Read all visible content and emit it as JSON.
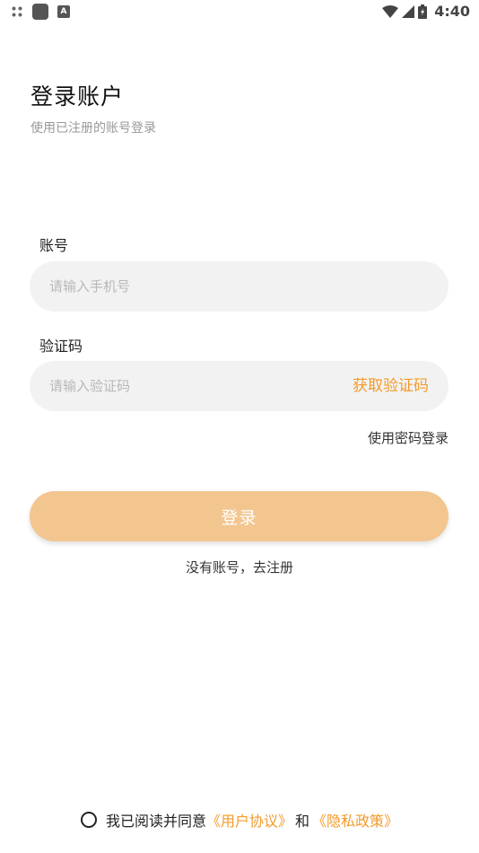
{
  "status_bar": {
    "time": "4:40",
    "left_icons": [
      "grid-icon",
      "app-square-icon",
      "a-box-icon"
    ],
    "right_icons": [
      "wifi-icon",
      "signal-icon",
      "battery-icon"
    ]
  },
  "header": {
    "title": "登录账户",
    "subtitle": "使用已注册的账号登录"
  },
  "form": {
    "account_label": "账号",
    "account_placeholder": "请输入手机号",
    "code_label": "验证码",
    "code_placeholder": "请输入验证码",
    "get_code_label": "获取验证码",
    "password_login_label": "使用密码登录"
  },
  "actions": {
    "login_label": "登录",
    "register_label": "没有账号，去注册"
  },
  "agreement": {
    "prefix": "我已阅读并同意",
    "user_agreement": "《用户协议》",
    "and": "和",
    "privacy_policy": "《隐私政策》"
  },
  "colors": {
    "accent": "#f29b2b",
    "login_button": "#f3c690",
    "input_bg": "#f2f2f2"
  }
}
